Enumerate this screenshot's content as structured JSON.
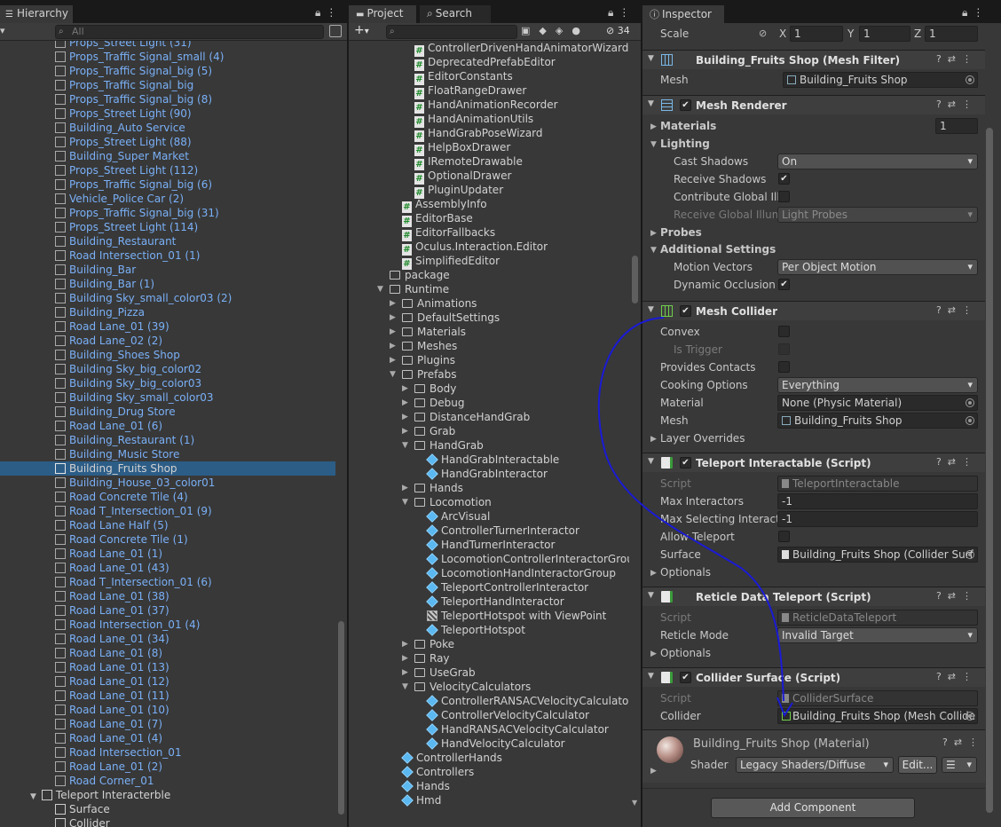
{
  "hierarchy": {
    "tab": "Hierarchy",
    "search_placeholder": "All",
    "items": [
      "Props_Street Light (31)",
      "Props_Traffic Signal_small (4)",
      "Props_Traffic Signal_big (5)",
      "Props_Traffic Signal_big",
      "Props_Traffic Signal_big (8)",
      "Props_Street Light (90)",
      "Building_Auto Service",
      "Props_Street Light (88)",
      "Building_Super Market",
      "Props_Street Light (112)",
      "Props_Traffic Signal_big (6)",
      "Vehicle_Police Car (2)",
      "Props_Traffic Signal_big (31)",
      "Props_Street Light (114)",
      "Building_Restaurant",
      "Road Intersection_01 (1)",
      "Building_Bar",
      "Building_Bar (1)",
      "Building Sky_small_color03 (2)",
      "Building_Pizza",
      "Road Lane_01 (39)",
      "Road Lane_02 (2)",
      "Building_Shoes Shop",
      "Building Sky_big_color02",
      "Building Sky_big_color03",
      "Building Sky_small_color03",
      "Building_Drug Store",
      "Road Lane_01 (6)",
      "Building_Restaurant (1)",
      "Building_Music Store",
      "Building_Fruits  Shop",
      "Building_House_03_color01",
      "Road Concrete Tile (4)",
      "Road T_Intersection_01 (9)",
      "Road Lane Half (5)",
      "Road Concrete Tile (1)",
      "Road Lane_01 (1)",
      "Road Lane_01 (43)",
      "Road T_Intersection_01 (6)",
      "Road Lane_01 (38)",
      "Road Lane_01 (37)",
      "Road Intersection_01 (4)",
      "Road Lane_01 (34)",
      "Road Lane_01 (8)",
      "Road Lane_01 (13)",
      "Road Lane_01 (12)",
      "Road Lane_01 (11)",
      "Road Lane_01 (10)",
      "Road Lane_01 (7)",
      "Road Lane_01 (4)",
      "Road Intersection_01",
      "Road Lane_01 (2)",
      "Road Corner_01"
    ],
    "selected_index": 30,
    "root_object": "Teleport Interacterble",
    "children": [
      "Surface",
      "Collider"
    ]
  },
  "project": {
    "tab_project": "Project",
    "tab_search": "Search",
    "hidden_count": "34",
    "items": [
      {
        "indent": 4,
        "kind": "script",
        "label": "ControllerDrivenHandAnimatorWizard"
      },
      {
        "indent": 4,
        "kind": "script",
        "label": "DeprecatedPrefabEditor"
      },
      {
        "indent": 4,
        "kind": "script",
        "label": "EditorConstants"
      },
      {
        "indent": 4,
        "kind": "script",
        "label": "FloatRangeDrawer"
      },
      {
        "indent": 4,
        "kind": "script",
        "label": "HandAnimationRecorder"
      },
      {
        "indent": 4,
        "kind": "script",
        "label": "HandAnimationUtils"
      },
      {
        "indent": 4,
        "kind": "script",
        "label": "HandGrabPoseWizard"
      },
      {
        "indent": 4,
        "kind": "script",
        "label": "HelpBoxDrawer"
      },
      {
        "indent": 4,
        "kind": "script",
        "label": "IRemoteDrawable"
      },
      {
        "indent": 4,
        "kind": "script",
        "label": "OptionalDrawer"
      },
      {
        "indent": 4,
        "kind": "script",
        "label": "PluginUpdater"
      },
      {
        "indent": 3,
        "kind": "script",
        "label": "AssemblyInfo"
      },
      {
        "indent": 3,
        "kind": "script",
        "label": "EditorBase"
      },
      {
        "indent": 3,
        "kind": "script",
        "label": "EditorFallbacks"
      },
      {
        "indent": 3,
        "kind": "script",
        "label": "Oculus.Interaction.Editor"
      },
      {
        "indent": 3,
        "kind": "script",
        "label": "SimplifiedEditor"
      },
      {
        "indent": 2,
        "kind": "folder",
        "label": "package"
      },
      {
        "indent": 2,
        "kind": "folder-open",
        "label": "Runtime"
      },
      {
        "indent": 3,
        "kind": "folder-closed",
        "label": "Animations"
      },
      {
        "indent": 3,
        "kind": "folder-closed",
        "label": "DefaultSettings"
      },
      {
        "indent": 3,
        "kind": "folder-closed",
        "label": "Materials"
      },
      {
        "indent": 3,
        "kind": "folder-closed",
        "label": "Meshes"
      },
      {
        "indent": 3,
        "kind": "folder-closed",
        "label": "Plugins"
      },
      {
        "indent": 3,
        "kind": "folder-open",
        "label": "Prefabs"
      },
      {
        "indent": 4,
        "kind": "folder-closed",
        "label": "Body"
      },
      {
        "indent": 4,
        "kind": "folder-closed",
        "label": "Debug"
      },
      {
        "indent": 4,
        "kind": "folder-closed",
        "label": "DistanceHandGrab"
      },
      {
        "indent": 4,
        "kind": "folder-closed",
        "label": "Grab"
      },
      {
        "indent": 4,
        "kind": "folder-open",
        "label": "HandGrab"
      },
      {
        "indent": 5,
        "kind": "prefab",
        "label": "HandGrabInteractable"
      },
      {
        "indent": 5,
        "kind": "prefab",
        "label": "HandGrabInteractor"
      },
      {
        "indent": 4,
        "kind": "folder-closed",
        "label": "Hands"
      },
      {
        "indent": 4,
        "kind": "folder-open",
        "label": "Locomotion"
      },
      {
        "indent": 5,
        "kind": "prefab",
        "label": "ArcVisual"
      },
      {
        "indent": 5,
        "kind": "prefab",
        "label": "ControllerTurnerInteractor"
      },
      {
        "indent": 5,
        "kind": "prefab",
        "label": "HandTurnerInteractor"
      },
      {
        "indent": 5,
        "kind": "prefab",
        "label": "LocomotionControllerInteractorGroup"
      },
      {
        "indent": 5,
        "kind": "prefab",
        "label": "LocomotionHandInteractorGroup"
      },
      {
        "indent": 5,
        "kind": "prefab",
        "label": "TeleportControllerInteractor"
      },
      {
        "indent": 5,
        "kind": "prefab",
        "label": "TeleportHandInteractor"
      },
      {
        "indent": 5,
        "kind": "variant",
        "label": "TeleportHotspot with ViewPoint"
      },
      {
        "indent": 5,
        "kind": "prefab",
        "label": "TeleportHotspot"
      },
      {
        "indent": 4,
        "kind": "folder-closed",
        "label": "Poke"
      },
      {
        "indent": 4,
        "kind": "folder-closed",
        "label": "Ray"
      },
      {
        "indent": 4,
        "kind": "folder-closed",
        "label": "UseGrab"
      },
      {
        "indent": 4,
        "kind": "folder-open",
        "label": "VelocityCalculators"
      },
      {
        "indent": 5,
        "kind": "prefab",
        "label": "ControllerRANSACVelocityCalculator"
      },
      {
        "indent": 5,
        "kind": "prefab",
        "label": "ControllerVelocityCalculator"
      },
      {
        "indent": 5,
        "kind": "prefab",
        "label": "HandRANSACVelocityCalculator"
      },
      {
        "indent": 5,
        "kind": "prefab",
        "label": "HandVelocityCalculator"
      },
      {
        "indent": 3,
        "kind": "prefab",
        "label": "ControllerHands"
      },
      {
        "indent": 3,
        "kind": "prefab",
        "label": "Controllers"
      },
      {
        "indent": 3,
        "kind": "prefab",
        "label": "Hands"
      },
      {
        "indent": 3,
        "kind": "prefab",
        "label": "Hmd"
      }
    ]
  },
  "inspector": {
    "tab": "Inspector",
    "scale": {
      "label": "Scale",
      "x_label": "X",
      "x": "1",
      "y_label": "Y",
      "y": "1",
      "z_label": "Z",
      "z": "1"
    },
    "mesh_filter": {
      "title": "Building_Fruits  Shop (Mesh Filter)",
      "mesh_label": "Mesh",
      "mesh_value": "Building_Fruits  Shop"
    },
    "mesh_renderer": {
      "title": "Mesh Renderer",
      "materials_label": "Materials",
      "materials_count": "1",
      "lighting_label": "Lighting",
      "cast_shadows_label": "Cast Shadows",
      "cast_shadows_value": "On",
      "receive_shadows_label": "Receive Shadows",
      "contribute_gi_label": "Contribute Global Illu",
      "receive_gi_label": "Receive Global Illumi",
      "receive_gi_value": "Light Probes",
      "probes_label": "Probes",
      "additional_label": "Additional Settings",
      "motion_vectors_label": "Motion Vectors",
      "motion_vectors_value": "Per Object Motion",
      "dynamic_occlusion_label": "Dynamic Occlusion"
    },
    "mesh_collider": {
      "title": "Mesh Collider",
      "convex_label": "Convex",
      "is_trigger_label": "Is Trigger",
      "provides_contacts_label": "Provides Contacts",
      "cooking_label": "Cooking Options",
      "cooking_value": "Everything",
      "material_label": "Material",
      "material_value": "None (Physic Material)",
      "mesh_label": "Mesh",
      "mesh_value": "Building_Fruits  Shop",
      "layer_overrides_label": "Layer Overrides"
    },
    "teleport_interactable": {
      "title": "Teleport Interactable (Script)",
      "script_label": "Script",
      "script_value": "TeleportInteractable",
      "max_interactors_label": "Max Interactors",
      "max_interactors_value": "-1",
      "max_selecting_label": "Max Selecting Interacto",
      "max_selecting_value": "-1",
      "allow_teleport_label": "Allow Teleport",
      "surface_label": "Surface",
      "surface_value": "Building_Fruits  Shop (Collider Surf",
      "optionals_label": "Optionals"
    },
    "reticle": {
      "title": "Reticle Data Teleport (Script)",
      "script_label": "Script",
      "script_value": "ReticleDataTeleport",
      "mode_label": "Reticle Mode",
      "mode_value": "Invalid Target",
      "optionals_label": "Optionals"
    },
    "collider_surface": {
      "title": "Collider Surface (Script)",
      "script_label": "Script",
      "script_value": "ColliderSurface",
      "collider_label": "Collider",
      "collider_value": "Building_Fruits  Shop (Mesh Collide"
    },
    "material": {
      "title": "Building_Fruits  Shop (Material)",
      "shader_label": "Shader",
      "shader_value": "Legacy Shaders/Diffuse",
      "edit_label": "Edit..."
    },
    "add_component_label": "Add Component"
  },
  "colors": {
    "selection": "#2c5d87",
    "gameobject_text": "#7ab0f7",
    "annotation_stroke": "#1a1ad6"
  }
}
